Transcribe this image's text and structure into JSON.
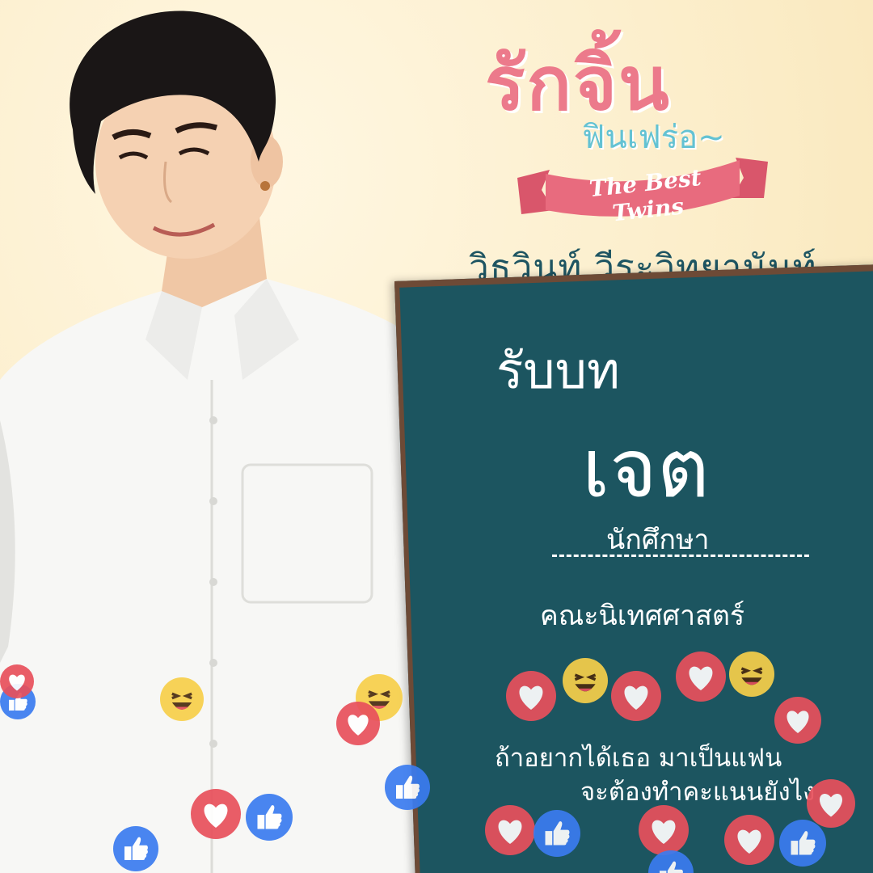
{
  "logo": {
    "title": "รักจิ้น",
    "subtitle": "ฟินเฟร่อ~",
    "ribbon_text": "The Best Twins"
  },
  "actor_name": "วิธวินท์ วีระวิทยานันท์",
  "board": {
    "intro": "รับบท",
    "character_name": "เจต",
    "occupation": "นักศึกษา",
    "faculty": "คณะนิเทศศาสตร์",
    "caption_line1": "ถ้าอยากได้เธอ มาเป็นแฟน",
    "caption_line2": "จะต้องทำคะแนนยังไง"
  },
  "colors": {
    "board": "#1c5560",
    "logo_pink": "#ec7a8b",
    "logo_blue": "#63c2d3",
    "ribbon": "#e86b7e",
    "background": "#fbedc8"
  },
  "icons": [
    "heart-reaction-icon",
    "like-reaction-icon",
    "haha-reaction-icon"
  ]
}
